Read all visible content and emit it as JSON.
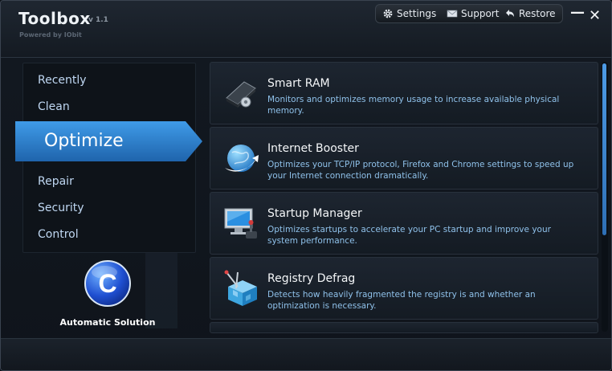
{
  "app": {
    "title": "Toolbox",
    "version": "v 1.1",
    "powered_by": "Powered by IObit"
  },
  "topbar": {
    "settings_label": "Settings",
    "support_label": "Support",
    "restore_label": "Restore"
  },
  "window_controls": {
    "minimize": "—",
    "close": "✕"
  },
  "sidebar": {
    "items": [
      {
        "label": "Recently"
      },
      {
        "label": "Clean"
      },
      {
        "label": "Optimize",
        "active": true
      },
      {
        "label": "Repair"
      },
      {
        "label": "Security"
      },
      {
        "label": "Control"
      }
    ]
  },
  "automatic": {
    "label": "Automatic Solution",
    "logo_letter": "C"
  },
  "tools": [
    {
      "title": "Smart RAM",
      "description": "Monitors and optimizes memory usage to increase available physical memory.",
      "icon": "ram-chip-icon"
    },
    {
      "title": "Internet Booster",
      "description": "Optimizes your TCP/IP protocol, Firefox and Chrome settings to speed up your Internet connection dramatically.",
      "icon": "globe-arrow-icon"
    },
    {
      "title": "Startup Manager",
      "description": "Optimizes startups to accelerate your PC startup and improve your system performance.",
      "icon": "monitor-joystick-icon"
    },
    {
      "title": "Registry Defrag",
      "description": "Detects how heavily fragmented the registry is and whether an optimization is necessary.",
      "icon": "registry-cube-icon"
    }
  ],
  "colors": {
    "accent": "#2f86d6",
    "link_text": "#8fc1ea",
    "nav_text": "#bfd7f2"
  }
}
